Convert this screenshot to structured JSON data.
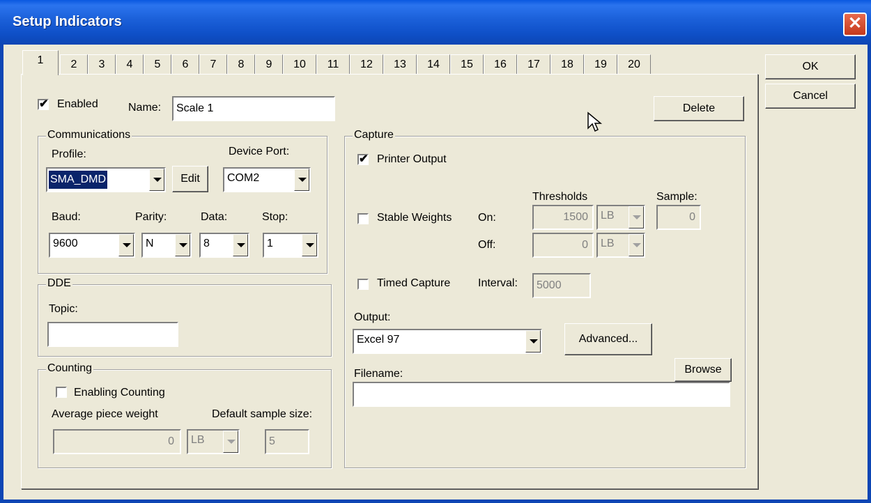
{
  "window": {
    "title": "Setup Indicators",
    "close_glyph": "✕"
  },
  "tabs": [
    "1",
    "2",
    "3",
    "4",
    "5",
    "6",
    "7",
    "8",
    "9",
    "10",
    "11",
    "12",
    "13",
    "14",
    "15",
    "16",
    "17",
    "18",
    "19",
    "20"
  ],
  "buttons": {
    "ok": "OK",
    "cancel": "Cancel",
    "delete": "Delete",
    "edit": "Edit",
    "advanced": "Advanced...",
    "browse": "Browse"
  },
  "general": {
    "enabled_label": "Enabled",
    "enabled_checked": true,
    "name_label": "Name:",
    "name_value": "Scale 1"
  },
  "communications": {
    "legend": "Communications",
    "profile_label": "Profile:",
    "profile_value": "SMA_DMD",
    "device_port_label": "Device Port:",
    "device_port_value": "COM2",
    "baud_label": "Baud:",
    "baud_value": "9600",
    "parity_label": "Parity:",
    "parity_value": "N",
    "data_label": "Data:",
    "data_value": "8",
    "stop_label": "Stop:",
    "stop_value": "1"
  },
  "dde": {
    "legend": "DDE",
    "topic_label": "Topic:",
    "topic_value": ""
  },
  "counting": {
    "legend": "Counting",
    "enable_label": "Enabling Counting",
    "enable_checked": false,
    "avg_label": "Average piece weight",
    "avg_value": "0",
    "avg_unit": "LB",
    "sample_label": "Default sample size:",
    "sample_value": "5"
  },
  "capture": {
    "legend": "Capture",
    "printer_label": "Printer Output",
    "printer_checked": true,
    "thresholds_label": "Thresholds",
    "sample_label": "Sample:",
    "sample_value": "0",
    "stable_label": "Stable Weights",
    "stable_checked": false,
    "on_label": "On:",
    "on_value": "1500",
    "on_unit": "LB",
    "off_label": "Off:",
    "off_value": "0",
    "off_unit": "LB",
    "timed_label": "Timed Capture",
    "timed_checked": false,
    "interval_label": "Interval:",
    "interval_value": "5000",
    "output_label": "Output:",
    "output_value": "Excel 97",
    "filename_label": "Filename:",
    "filename_value": ""
  },
  "colors": {
    "titlebar": "#0d46b4",
    "face": "#ece9d8",
    "selection": "#0a246a"
  }
}
